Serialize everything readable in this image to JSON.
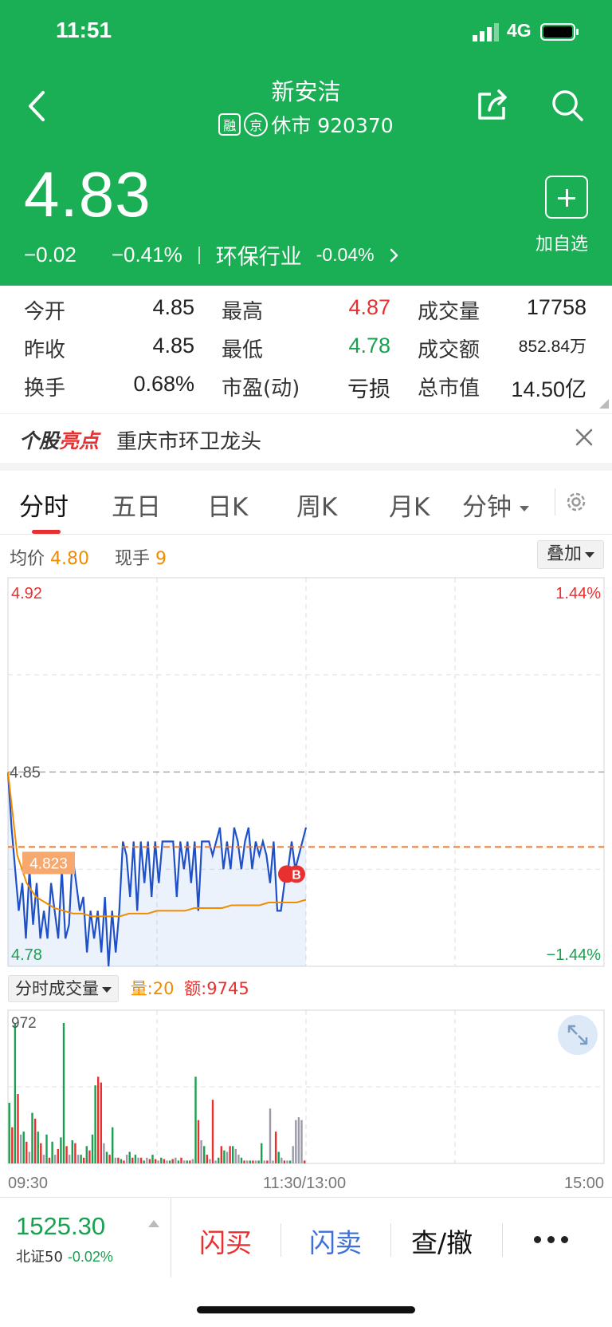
{
  "status_bar": {
    "time": "11:51",
    "network": "4G"
  },
  "header": {
    "stock_name": "新安洁",
    "tag_margin": "融",
    "tag_exchange": "京",
    "status_code": "休市 920370",
    "price": "4.83",
    "change": "−0.02",
    "change_pct": "−0.41%",
    "industry": "环保行业",
    "industry_change": "-0.04%",
    "add_watch_label": "加自选"
  },
  "quote": {
    "rows": [
      [
        {
          "label": "今开",
          "value": "4.85",
          "color": ""
        },
        {
          "label": "最高",
          "value": "4.87",
          "color": "red"
        },
        {
          "label": "成交量",
          "value": "17758",
          "color": ""
        }
      ],
      [
        {
          "label": "昨收",
          "value": "4.85",
          "color": ""
        },
        {
          "label": "最低",
          "value": "4.78",
          "color": "green"
        },
        {
          "label": "成交额",
          "value": "852.84万",
          "color": ""
        }
      ],
      [
        {
          "label": "换手",
          "value": "0.68%",
          "color": ""
        },
        {
          "label": "市盈(动)",
          "value": "亏损",
          "color": ""
        },
        {
          "label": "总市值",
          "value": "14.50亿",
          "color": ""
        }
      ]
    ]
  },
  "spotlight": {
    "logo_a": "个股",
    "logo_b": "亮点",
    "text": "重庆市环卫龙头"
  },
  "tabs": {
    "items": [
      "分时",
      "五日",
      "日K",
      "周K",
      "月K"
    ],
    "minute_label": "分钟",
    "active": 0
  },
  "chart_info": {
    "avg_label": "均价",
    "avg_value": "4.80",
    "hand_label": "现手",
    "hand_value": "9",
    "overlay_label": "叠加",
    "volume_selector": "分时成交量",
    "vol_label": "量:20",
    "amt_label": "额:9745"
  },
  "chart_data": [
    {
      "type": "line",
      "y_axis_labels": {
        "top": "4.92",
        "prev_close": "4.85",
        "bottom": "4.78"
      },
      "pct_labels": {
        "top": "1.44%",
        "bottom": "−1.44%"
      },
      "ylim": [
        4.78,
        4.92
      ],
      "prev_close": 4.85,
      "current_price_tag": "4.823",
      "trade_markers": [
        "B"
      ],
      "x_labels": [
        "09:30",
        "11:30/13:00",
        "15:00"
      ],
      "series": [
        {
          "values": [
            4.85,
            4.83,
            4.815,
            4.8,
            4.81,
            4.79,
            4.815,
            4.795,
            4.81,
            4.79,
            4.8,
            4.79,
            4.81,
            4.8,
            4.79,
            4.815,
            4.79,
            4.795,
            4.82,
            4.81,
            4.8,
            4.805,
            4.785,
            4.8,
            4.79,
            4.8,
            4.785,
            4.805,
            4.78,
            4.8,
            4.785,
            4.8,
            4.825,
            4.82,
            4.805,
            4.825,
            4.8,
            4.825,
            4.81,
            4.825,
            4.805,
            4.825,
            4.81,
            4.825,
            4.825,
            4.825,
            4.825,
            4.805,
            4.825,
            4.815,
            4.825,
            4.81,
            4.825,
            4.8,
            4.825,
            4.825,
            4.825,
            4.82,
            4.825,
            4.83,
            4.815,
            4.825,
            4.815,
            4.83,
            4.825,
            4.815,
            4.825,
            4.83,
            4.815,
            4.825,
            4.82,
            4.825,
            4.82,
            4.81,
            4.825,
            4.8,
            4.8,
            4.81,
            4.815,
            4.825,
            4.815,
            4.82,
            4.825,
            4.83
          ]
        },
        {
          "values": [
            4.85,
            4.82,
            4.81,
            4.805,
            4.803,
            4.801,
            4.8,
            4.799,
            4.799,
            4.798,
            4.798,
            4.798,
            4.798,
            4.799,
            4.799,
            4.799,
            4.8,
            4.8,
            4.8,
            4.8,
            4.801,
            4.801,
            4.801,
            4.801,
            4.802,
            4.802,
            4.802,
            4.802,
            4.803,
            4.803,
            4.803,
            4.803,
            4.804
          ]
        }
      ]
    },
    {
      "type": "bar",
      "y_max_label": "972",
      "values": [
        420,
        250,
        972,
        480,
        200,
        220,
        150,
        80,
        350,
        310,
        220,
        140,
        60,
        200,
        40,
        150,
        60,
        100,
        180,
        972,
        120,
        60,
        160,
        140,
        60,
        60,
        40,
        120,
        90,
        200,
        540,
        600,
        560,
        140,
        80,
        60,
        250,
        40,
        40,
        30,
        20,
        60,
        80,
        40,
        60,
        40,
        40,
        20,
        40,
        30,
        60,
        30,
        20,
        40,
        30,
        20,
        20,
        30,
        40,
        20,
        40,
        20,
        20,
        20,
        30,
        600,
        300,
        160,
        120,
        60,
        30,
        440,
        20,
        40,
        120,
        90,
        80,
        120,
        120,
        100,
        60,
        40,
        20,
        20,
        20,
        20,
        20,
        20,
        140,
        20,
        20,
        380,
        20,
        220,
        80,
        40,
        20,
        20,
        20,
        120,
        300,
        320,
        300,
        20
      ],
      "colors": [
        "green",
        "red",
        "green",
        "red",
        "gray",
        "green",
        "red",
        "gray",
        "green",
        "red",
        "green",
        "red",
        "gray",
        "green",
        "red",
        "green",
        "gray",
        "red",
        "green",
        "green",
        "red",
        "gray",
        "green",
        "red",
        "gray",
        "green",
        "red",
        "green",
        "red",
        "green",
        "green",
        "red",
        "red",
        "gray",
        "green",
        "red",
        "green",
        "gray",
        "red",
        "green",
        "red",
        "gray",
        "green",
        "red",
        "green",
        "gray",
        "red",
        "green",
        "gray",
        "red",
        "green",
        "red",
        "gray",
        "green",
        "red",
        "gray",
        "green",
        "red",
        "gray",
        "green",
        "red",
        "gray",
        "green",
        "red",
        "gray",
        "green",
        "red",
        "gray",
        "green",
        "red",
        "gray",
        "red",
        "gray",
        "green",
        "red",
        "green",
        "gray",
        "red",
        "green",
        "gray",
        "gray",
        "green",
        "red",
        "gray",
        "green",
        "red",
        "gray",
        "green",
        "green",
        "gray",
        "red",
        "gray",
        "gray",
        "red",
        "green",
        "gray",
        "red",
        "gray",
        "green",
        "gray",
        "gray",
        "gray",
        "gray",
        "red"
      ]
    }
  ],
  "bottom_bar": {
    "index_value": "1525.30",
    "index_name": "北证50",
    "index_change": "-0.02%",
    "buy": "闪买",
    "sell": "闪卖",
    "query": "查/撤"
  },
  "colors": {
    "brand_green": "#1aaf54",
    "up_red": "#e93030",
    "down_green": "#1aa050",
    "avg_orange": "#f08c00",
    "price_blue": "#1e50c8"
  }
}
